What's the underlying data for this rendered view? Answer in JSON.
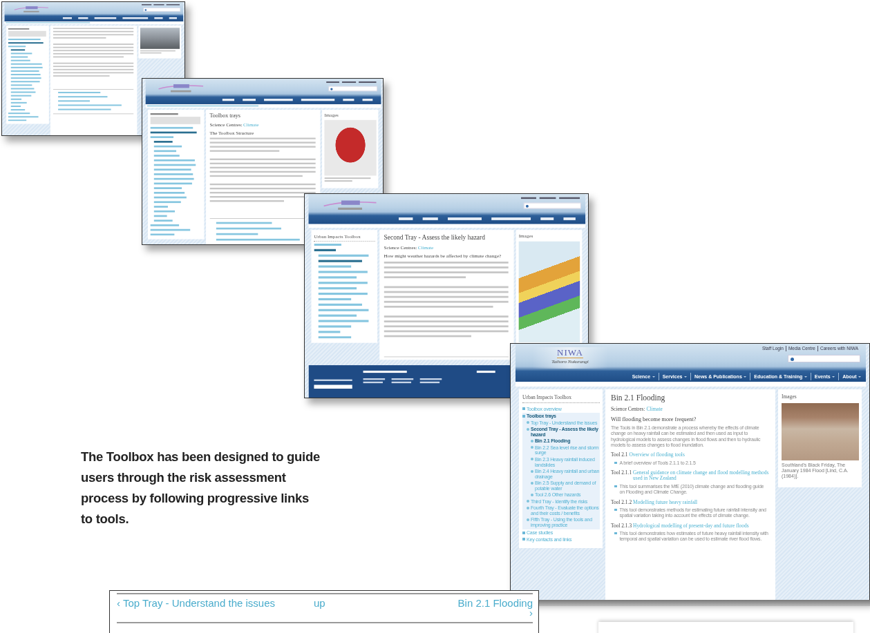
{
  "background_pages": [
    {
      "breadcrumb": true,
      "footer": false,
      "image": {
        "kind": "road"
      }
    },
    {
      "breadcrumb": true,
      "footer": false,
      "title": "Toolbox trays",
      "science_centres_label": "Science Centres:",
      "science_centre": "Climate",
      "heading": "The Toolbox Structure",
      "images_title": "Images",
      "image": {
        "kind": "toolbox"
      }
    },
    {
      "breadcrumb": false,
      "footer": true,
      "sidebar_title": "Urban Impacts Toolbox",
      "title": "Second Tray - Assess the likely hazard",
      "science_centres_label": "Science Centres:",
      "science_centre": "Climate",
      "heading": "How might weather hazards be affected by climate change?",
      "images_title": "Images",
      "image": {
        "kind": "map"
      }
    }
  ],
  "page": {
    "logo": {
      "name": "NIWA",
      "tagline": "Taihoro Nukurangi"
    },
    "top_links": [
      "Staff Login",
      "Media Centre",
      "Careers with NIWA"
    ],
    "nav": [
      {
        "label": "Science",
        "selected": false
      },
      {
        "label": "Services",
        "selected": false
      },
      {
        "label": "News & Publications",
        "selected": false
      },
      {
        "label": "Education & Training",
        "selected": false
      },
      {
        "label": "Events",
        "selected": false
      },
      {
        "label": "About",
        "selected": false
      }
    ],
    "sidebar": {
      "title": "Urban Impacts Toolbox",
      "round_bullets": true,
      "items": [
        {
          "label": "Toolbox overview",
          "selected": false
        },
        {
          "label": "Toolbox trays",
          "selected": true,
          "children": [
            {
              "label": "Top Tray - Understand the issues",
              "selected": false
            },
            {
              "label": "Second Tray - Assess the likely hazard",
              "selected": true,
              "children": [
                {
                  "label": "Bin 2.1 Flooding",
                  "selected": true
                },
                {
                  "label": "Bin 2.2 Sea level rise and storm surge",
                  "selected": false
                },
                {
                  "label": "Bin 2.3 Heavy rainfall induced landslides",
                  "selected": false
                },
                {
                  "label": "Bin 2.4 Heavy rainfall and urban drainage",
                  "selected": false
                },
                {
                  "label": "Bin 2.5 Supply and demand of potable water",
                  "selected": false
                },
                {
                  "label": "Tool 2.6 Other hazards",
                  "selected": false
                }
              ]
            },
            {
              "label": "Third Tray - Identify the risks",
              "selected": false
            },
            {
              "label": "Fourth Tray - Evaluate the options and their costs / benefits",
              "selected": false
            },
            {
              "label": "Fifth Tray - Using the tools and improving practice",
              "selected": false
            }
          ]
        },
        {
          "label": "Case studies",
          "selected": false
        },
        {
          "label": "Key contacts and links",
          "selected": false
        }
      ]
    },
    "main": {
      "title": "Bin 2.1 Flooding",
      "science_centres_label": "Science Centres:",
      "science_centre": "Climate",
      "heading": "Will flooding become more frequent?",
      "paragraphs": [
        "The Tools in Bin 2.1 demonstrate a process whereby the effects of climate change on heavy rainfall can be estimated and then used as input to hydrological models to assess changes in flood flows and then to hydraulic models to assess changes to flood inundation."
      ],
      "tools": [
        {
          "number": "Tool 2.1",
          "title": "Overview of flooding tools",
          "description": "A brief overview of Tools 2.1.1 to 2.1.5"
        },
        {
          "number": "Tool 2.1.1",
          "title": "General guidance on climate change and flood modelling methods used in New Zealand",
          "description": "This tool summarises the MfE (2010) climate change and flooding guide on Flooding and Climate Change."
        },
        {
          "number": "Tool 2.1.2",
          "title": "Modelling future heavy rainfall",
          "description": "This tool demonstrates methods for estimating future rainfall intensity and spatial variation taking into account the effects of climate change."
        },
        {
          "number": "Tool 2.1.3",
          "title": "Hydrological modelling of present-day and future floods",
          "description": "This tool demonstrates how estimates of future heavy rainfall intensity with temporal and spatial variation can be used to estimate river flood flows."
        }
      ]
    },
    "images": {
      "title": "Images",
      "kind": "flood",
      "caption": "Southland's Black Friday, The January 1984 Flood [Lind, C.A. (1984)]."
    }
  },
  "caption": "The Toolbox has been designed to guide users through the risk assessment process by following progressive links to tools.",
  "pager_detail": {
    "prev": "‹ Top Tray - Understand the issues",
    "up": "up",
    "next": "Bin 2.1 Flooding ›"
  }
}
